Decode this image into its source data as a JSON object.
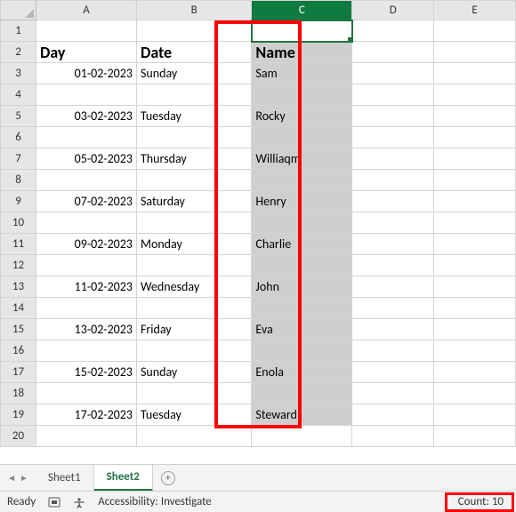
{
  "column_headers": [
    "A",
    "B",
    "C",
    "D",
    "E"
  ],
  "row_headers": [
    "1",
    "2",
    "3",
    "4",
    "5",
    "6",
    "7",
    "8",
    "9",
    "10",
    "11",
    "12",
    "13",
    "14",
    "15",
    "16",
    "17",
    "18",
    "19",
    "20"
  ],
  "selected_column": "C",
  "active_cell": "C1",
  "table": {
    "header": {
      "A": "Day",
      "B": "Date",
      "C": "Name"
    },
    "rows": [
      {
        "r": 3,
        "A": "01-02-2023",
        "B": "Sunday",
        "C": "Sam"
      },
      {
        "r": 4,
        "A": "",
        "B": "",
        "C": ""
      },
      {
        "r": 5,
        "A": "03-02-2023",
        "B": "Tuesday",
        "C": "Rocky"
      },
      {
        "r": 6,
        "A": "",
        "B": "",
        "C": ""
      },
      {
        "r": 7,
        "A": "05-02-2023",
        "B": "Thursday",
        "C": "Williaqm"
      },
      {
        "r": 8,
        "A": "",
        "B": "",
        "C": ""
      },
      {
        "r": 9,
        "A": "07-02-2023",
        "B": "Saturday",
        "C": "Henry"
      },
      {
        "r": 10,
        "A": "",
        "B": "",
        "C": ""
      },
      {
        "r": 11,
        "A": "09-02-2023",
        "B": "Monday",
        "C": "Charlie"
      },
      {
        "r": 12,
        "A": "",
        "B": "",
        "C": ""
      },
      {
        "r": 13,
        "A": "11-02-2023",
        "B": "Wednesday",
        "C": "John"
      },
      {
        "r": 14,
        "A": "",
        "B": "",
        "C": ""
      },
      {
        "r": 15,
        "A": "13-02-2023",
        "B": "Friday",
        "C": "Eva"
      },
      {
        "r": 16,
        "A": "",
        "B": "",
        "C": ""
      },
      {
        "r": 17,
        "A": "15-02-2023",
        "B": "Sunday",
        "C": "Enola"
      },
      {
        "r": 18,
        "A": "",
        "B": "",
        "C": ""
      },
      {
        "r": 19,
        "A": "17-02-2023",
        "B": "Tuesday",
        "C": "Steward"
      }
    ]
  },
  "sheets": {
    "tabs": [
      "Sheet1",
      "Sheet2"
    ],
    "active": "Sheet2"
  },
  "status": {
    "ready": "Ready",
    "accessibility": "Accessibility: Investigate",
    "count_label": "Count: 10"
  }
}
